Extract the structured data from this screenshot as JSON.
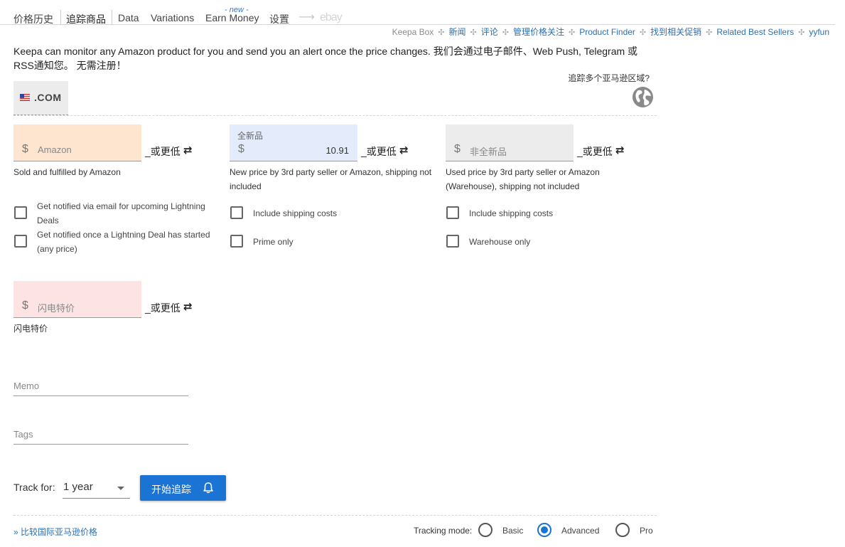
{
  "nav": {
    "tabs": [
      "价格历史",
      "追踪商品",
      "Data",
      "Variations",
      "Earn Money",
      "设置"
    ],
    "new_badge": "- new -",
    "arrow": "⟶",
    "ebay": "ebay"
  },
  "subnav": {
    "items": [
      "Keepa Box",
      "新闻",
      "评论",
      "管理价格关注",
      "Product Finder",
      "找到相关促销",
      "Related Best Sellers",
      "yyfun"
    ],
    "separator": "✣"
  },
  "intro": {
    "text": "Keepa can monitor any Amazon product for you and send you an alert once the price changes. 我们会通过电子邮件、Web Push, Telegram 或 RSS通知您。 无需注册！"
  },
  "domain": {
    "label": ".COM",
    "multi_domain_text": "追踪多个亚马逊区域?",
    "globe_icon": "globe-icon",
    "flag_icon": "us-flag-icon"
  },
  "prices": {
    "currency": "$",
    "or_lower": "_或更低",
    "swap_icon": "⇄",
    "amazon": {
      "placeholder": "Amazon",
      "bg": "#fde5cf",
      "desc": "Sold and fulfilled by Amazon"
    },
    "new": {
      "float_label": "全新品",
      "value": "10.91",
      "bg": "#e4ecfb",
      "desc": "New price by 3rd party seller or Amazon, shipping not included"
    },
    "used": {
      "placeholder": "非全新品",
      "bg": "#ececec",
      "desc": "Used price by 3rd party seller or Amazon (Warehouse), shipping not included"
    },
    "lightning": {
      "placeholder": "闪电特价",
      "bg": "#fde3e3",
      "desc": "闪电特价"
    }
  },
  "options": {
    "amazon": [
      "Get notified via email for upcoming Lightning Deals",
      "Get notified once a Lightning Deal has started (any price)"
    ],
    "new": [
      "Include shipping costs",
      "Prime only"
    ],
    "used": [
      "Include shipping costs",
      "Warehouse only"
    ]
  },
  "memo": {
    "placeholder": "Memo"
  },
  "tags": {
    "placeholder": "Tags"
  },
  "track": {
    "label": "Track for:",
    "selected": "1 year",
    "button": "开始追踪",
    "bell_icon": "bell-icon"
  },
  "footer": {
    "compare_link": "» 比较国际亚马逊价格",
    "tracking_mode_label": "Tracking mode:",
    "modes": [
      "Basic",
      "Advanced",
      "Pro"
    ],
    "selected_mode": "Advanced"
  },
  "colors": {
    "accent": "#1b73d3",
    "link": "#2a6fb4"
  }
}
